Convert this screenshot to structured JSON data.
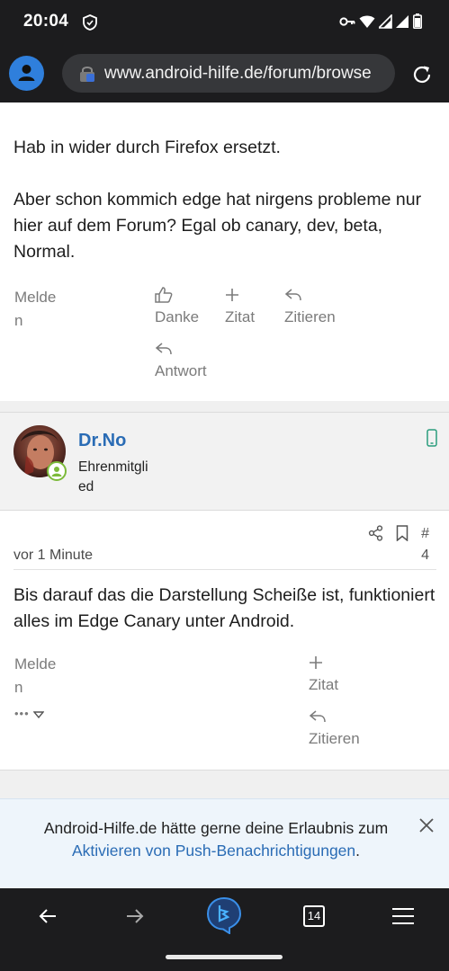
{
  "status_bar": {
    "time": "20:04",
    "icons": [
      "shield-icon",
      "key-icon",
      "wifi-icon",
      "signal-icon",
      "signal-icon",
      "battery-icon"
    ]
  },
  "browser": {
    "url": "www.android-hilfe.de/forum/browse",
    "tab_count": "14"
  },
  "post_prev": {
    "line1": "Hab in wider durch Firefox ersetzt.",
    "line2": "Aber schon kommich edge hat nirgens probleme nur hier auf dem Forum? Egal ob canary, dev, beta, Normal.",
    "report_l1": "Melde",
    "report_l2": "n",
    "like_label": "Danke",
    "quote_plus_label": "Zitat",
    "quote_label": "Zitieren",
    "reply_label": "Antwort"
  },
  "user": {
    "name": "Dr.No",
    "rank_l1": "Ehrenmitgli",
    "rank_l2": "ed"
  },
  "post": {
    "time": "vor 1 Minute",
    "number_hash": "#",
    "number": "4",
    "text": "Bis darauf das die Darstellung Scheiße ist, funktioniert alles im Edge Canary unter Android.",
    "report_l1": "Melde",
    "report_l2": "n",
    "more": "•••",
    "quote_plus_label": "Zitat",
    "quote_label": "Zitieren"
  },
  "banner": {
    "text": "Android-Hilfe.de hätte gerne deine Erlaubnis zum",
    "link": "Aktivieren von Push-Benachrichtigungen",
    "suffix": "."
  },
  "colors": {
    "accent": "#2a6cb5",
    "dark_bar": "#1c1c1e",
    "online": "#7cba3a"
  }
}
